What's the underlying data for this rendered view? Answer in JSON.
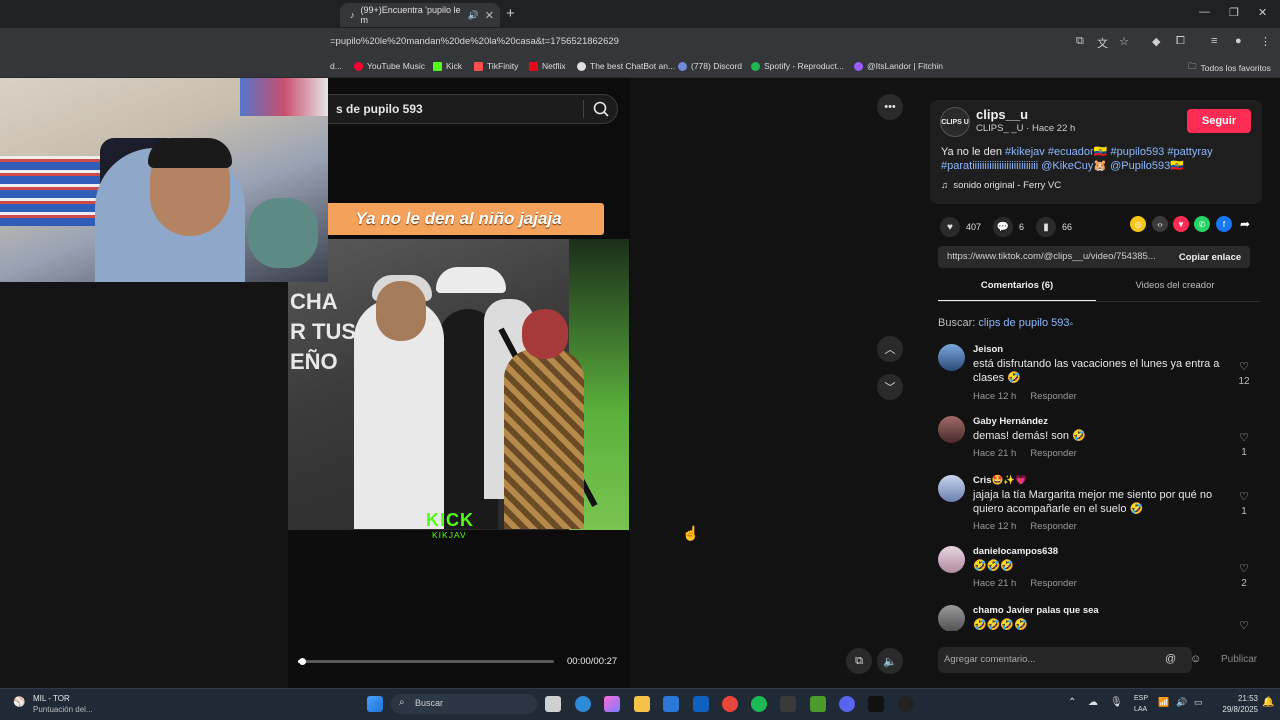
{
  "browser": {
    "tab_title": "(99+)Encuentra 'pupilo le m",
    "url": "=pupilo%20le%20mandan%20de%20la%20casa&t=1756521862629",
    "bookmarks": [
      "d...",
      "YouTube Music",
      "Kick",
      "TikFinity",
      "Netflix",
      "The best ChatBot an...",
      "(778) Discord",
      "Spotify - Reproduct...",
      "@ItsLandor | Fitchin"
    ],
    "all_favorites": "Todos los favoritos"
  },
  "search": {
    "query": "s de pupilo 593"
  },
  "video": {
    "caption": "Ya no le den al niño jajaja",
    "brand": "KICK",
    "channel": "KIKJAV",
    "time": "00:00/00:27",
    "progress_fraction": 0.01
  },
  "creator": {
    "avatar_text": "CLIPS U",
    "username": "clips__u",
    "meta": "CLIPS_ _U · Hace 22 h",
    "follow_label": "Seguir",
    "desc_prefix": "Ya no le den ",
    "tags": [
      "#kikejav",
      "#ecuador🇪🇨",
      "#pupilo593",
      "#pattyray",
      "#paratiiiiiiiiiiiiiiiiiiiiiiiiiii",
      "@KikeCuy🐹",
      "@Pupilo593🇪🇨"
    ],
    "sound": "sonido original - Ferry VC"
  },
  "stats": {
    "likes": "407",
    "comments": "6",
    "saves": "66"
  },
  "link": {
    "url": "https://www.tiktok.com/@clips__u/video/754385...",
    "copy_label": "Copiar enlace"
  },
  "tabs": {
    "comments": "Comentarios (6)",
    "videos": "Videos del creador"
  },
  "buscar": {
    "label": "Buscar: ",
    "query": "clips de pupilo 593"
  },
  "comments": [
    {
      "name": "Jeison",
      "text": "está disfrutando las vacaciones el lunes ya entra a clases 🤣",
      "time": "Hace 12 h",
      "reply": "Responder",
      "likes": "12"
    },
    {
      "name": "Gaby Hernández",
      "text": "demas! demás! son 🤣",
      "time": "Hace 21 h",
      "reply": "Responder",
      "likes": "1"
    },
    {
      "name": "Cris🤩✨💗",
      "text": "jajaja la tía Margarita mejor me siento por qué no quiero acompañarle en el suelo 🤣",
      "time": "Hace 12 h",
      "reply": "Responder",
      "likes": "1"
    },
    {
      "name": "danielocampos638",
      "text": "🤣🤣🤣",
      "time": "Hace 21 h",
      "reply": "Responder",
      "likes": "2"
    },
    {
      "name": "chamo Javier palas que sea",
      "text": "🤣🤣🤣🤣",
      "time": "",
      "reply": "",
      "likes": ""
    }
  ],
  "compose": {
    "placeholder": "Agregar comentario...",
    "publish": "Publicar"
  },
  "taskbar": {
    "weather_name": "MIL - TOR",
    "weather_sub": "Puntuación del...",
    "search": "Buscar",
    "lang1": "ESP",
    "lang2": "LAA",
    "time": "21:53",
    "date": "29/8/2025"
  }
}
